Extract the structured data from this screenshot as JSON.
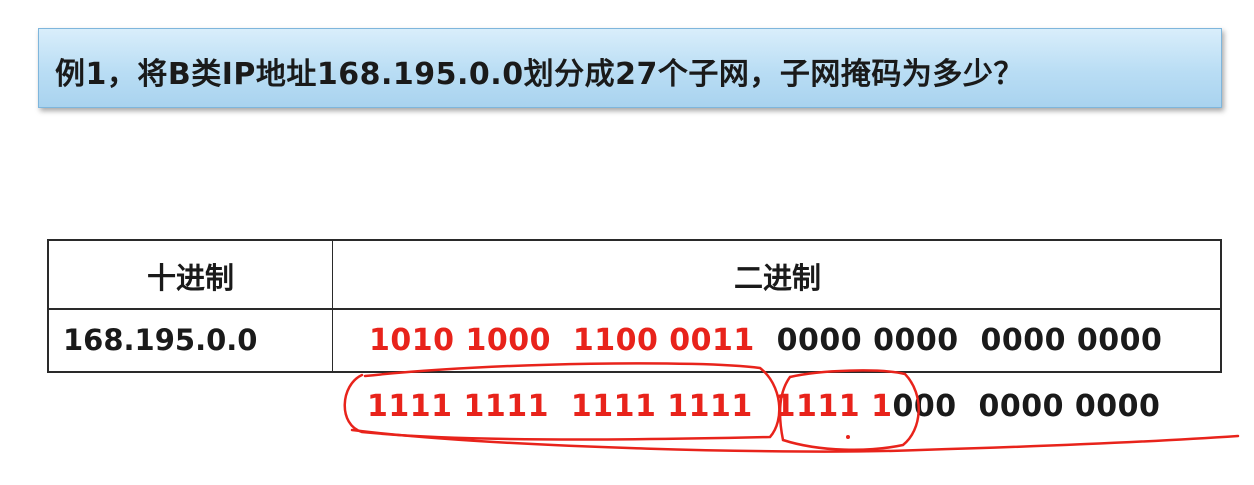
{
  "title": "例1，将B类IP地址168.195.0.0划分成27个子网，子网掩码为多少？",
  "table": {
    "header_decimal": "十进制",
    "header_binary": "二进制",
    "row_decimal": "168.195.0.0",
    "row_binary_red": "1010 1000  1100 0011",
    "row_binary_black": "  0000 0000  0000 0000"
  },
  "mask": {
    "red_part": "1111 1111  1111 1111  1111 1",
    "black_part": "000  0000 0000"
  },
  "colors": {
    "red": "#e8231b",
    "text": "#1a1a1a",
    "title_bg": "#b9ddf4"
  }
}
